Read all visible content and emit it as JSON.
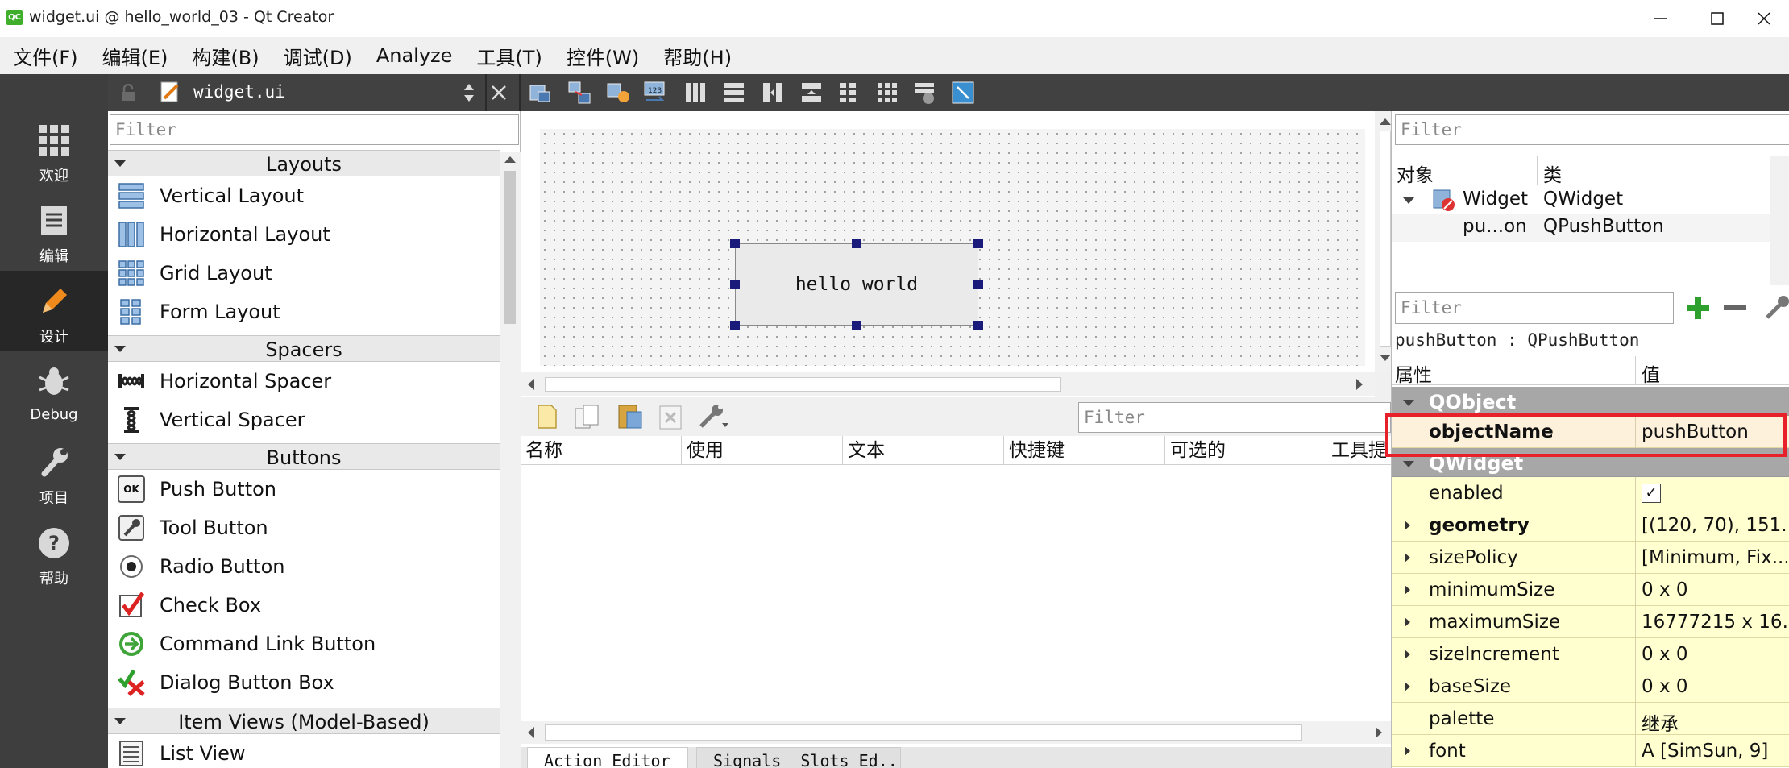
{
  "window": {
    "title": "widget.ui @ hello_world_03 - Qt Creator",
    "app_icon_text": "QC"
  },
  "menu": [
    "文件(F)",
    "编辑(E)",
    "构建(B)",
    "调试(D)",
    "Analyze",
    "工具(T)",
    "控件(W)",
    "帮助(H)"
  ],
  "modes": [
    {
      "label": "欢迎",
      "icon": "grid-icon"
    },
    {
      "label": "编辑",
      "icon": "document-icon"
    },
    {
      "label": "设计",
      "icon": "pencil-icon",
      "active": true
    },
    {
      "label": "Debug",
      "icon": "bug-icon"
    },
    {
      "label": "项目",
      "icon": "wrench-icon"
    },
    {
      "label": "帮助",
      "icon": "help-icon"
    }
  ],
  "doc_toolbar": {
    "file_name": "widget.ui"
  },
  "widget_box": {
    "filter_placeholder": "Filter",
    "categories": {
      "layouts": "Layouts",
      "spacers": "Spacers",
      "buttons": "Buttons",
      "item_views": "Item Views (Model-Based)"
    },
    "items": {
      "vertical_layout": "Vertical Layout",
      "horizontal_layout": "Horizontal Layout",
      "grid_layout": "Grid Layout",
      "form_layout": "Form Layout",
      "horizontal_spacer": "Horizontal Spacer",
      "vertical_spacer": "Vertical Spacer",
      "push_button": "Push Button",
      "tool_button": "Tool Button",
      "radio_button": "Radio Button",
      "check_box": "Check Box",
      "command_link_button": "Command Link Button",
      "dialog_button_box": "Dialog Button Box",
      "list_view": "List View"
    },
    "push_button_icon_text": "OK"
  },
  "form": {
    "button_text": "hello world"
  },
  "action_editor": {
    "filter_placeholder": "Filter",
    "columns": [
      "名称",
      "使用",
      "文本",
      "快捷键",
      "可选的",
      "工具提"
    ],
    "tabs": [
      "Action Editor",
      "Signals _Slots Ed..."
    ]
  },
  "object_inspector": {
    "filter_placeholder": "Filter",
    "col_object": "对象",
    "col_class": "类",
    "rows": [
      {
        "object": "Widget",
        "class": "QWidget"
      },
      {
        "object": "pu...on",
        "class": "QPushButton"
      }
    ]
  },
  "property_editor": {
    "filter_placeholder": "Filter",
    "selected_label": "pushButton : QPushButton",
    "col_property": "属性",
    "col_value": "值",
    "groups": {
      "qobject": "QObject",
      "qwidget": "QWidget"
    },
    "object_name": {
      "name": "objectName",
      "value": "pushButton"
    },
    "enabled": {
      "name": "enabled",
      "value": "✓"
    },
    "props": [
      {
        "name": "geometry",
        "value": "[(120, 70), 151..."
      },
      {
        "name": "sizePolicy",
        "value": "[Minimum, Fix..."
      },
      {
        "name": "minimumSize",
        "value": "0 x 0"
      },
      {
        "name": "maximumSize",
        "value": "16777215 x 16..."
      },
      {
        "name": "sizeIncrement",
        "value": "0 x 0"
      },
      {
        "name": "baseSize",
        "value": "0 x 0"
      },
      {
        "name": "palette",
        "value": "继承"
      },
      {
        "name": "font",
        "value": "A  [SimSun, 9]"
      }
    ]
  },
  "colors": {
    "mode_bar": "#3e3e3e",
    "active_mode": "#272727",
    "property_group": "#a7a7a7",
    "property_row": "#ffffcf",
    "highlight_border": "#e8202a",
    "selection_handle": "#1a1a7a",
    "add_icon": "#2ea02e"
  }
}
